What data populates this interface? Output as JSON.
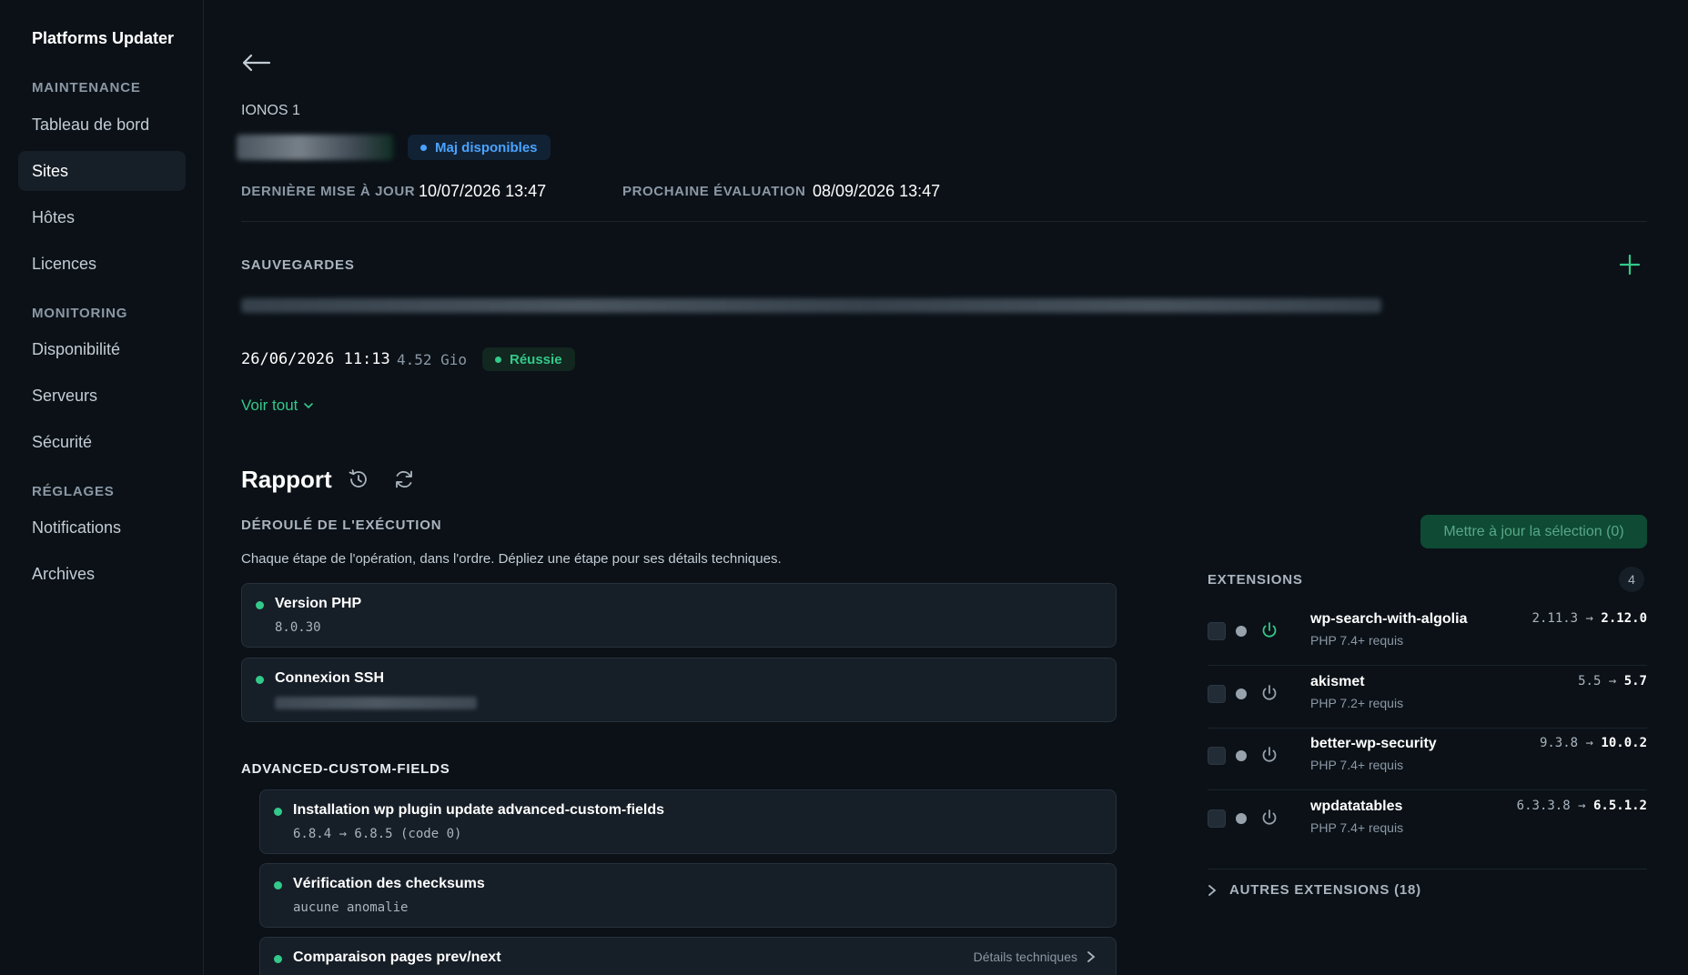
{
  "app": {
    "title": "Platforms Updater"
  },
  "sidebar": {
    "sections": [
      {
        "title": "MAINTENANCE",
        "items": [
          "Tableau de bord",
          "Sites",
          "Hôtes",
          "Licences"
        ]
      },
      {
        "title": "MONITORING",
        "items": [
          "Disponibilité",
          "Serveurs",
          "Sécurité"
        ]
      },
      {
        "title": "RÉGLAGES",
        "items": [
          "Notifications",
          "Archives"
        ]
      }
    ],
    "active": "Sites"
  },
  "site": {
    "host": "IONOS 1",
    "status_badge": "Maj disponibles",
    "last_update_label": "DERNIÈRE MISE À JOUR",
    "last_update_value": "10/07/2026 13:47",
    "next_eval_label": "PROCHAINE ÉVALUATION",
    "next_eval_value": "08/09/2026 13:47"
  },
  "backups": {
    "title": "SAUVEGARDES",
    "latest": {
      "date": "26/06/2026 11:13",
      "size": "4.52 Gio",
      "status": "Réussie"
    },
    "see_all": "Voir tout"
  },
  "report": {
    "title": "Rapport",
    "exec_title": "DÉROULÉ DE L'EXÉCUTION",
    "exec_desc": "Chaque étape de l'opération, dans l'ordre. Dépliez une étape pour ses détails techniques.",
    "steps": [
      {
        "title": "Version PHP",
        "sub": "8.0.30"
      },
      {
        "title": "Connexion SSH",
        "sub": ""
      }
    ],
    "group_title": "ADVANCED-CUSTOM-FIELDS",
    "group_steps": [
      {
        "title": "Installation wp plugin update advanced-custom-fields",
        "sub": "6.8.4 → 6.8.5 (code 0)"
      },
      {
        "title": "Vérification des checksums",
        "sub": "aucune anomalie"
      },
      {
        "title": "Comparaison pages prev/next",
        "details": "Détails techniques"
      }
    ]
  },
  "extensions": {
    "update_button": "Mettre à jour la sélection (0)",
    "title": "EXTENSIONS",
    "count": "4",
    "items": [
      {
        "name": "wp-search-with-algolia",
        "req": "PHP 7.4+ requis",
        "from": "2.11.3",
        "arrow": "→",
        "to": "2.12.0",
        "power_color": "#33c98a"
      },
      {
        "name": "akismet",
        "req": "PHP 7.2+ requis",
        "from": "5.5",
        "arrow": "→",
        "to": "5.7",
        "power_color": "#98a2ac"
      },
      {
        "name": "better-wp-security",
        "req": "PHP 7.4+ requis",
        "from": "9.3.8",
        "arrow": "→",
        "to": "10.0.2",
        "power_color": "#98a2ac"
      },
      {
        "name": "wpdatatables",
        "req": "PHP 7.4+ requis",
        "from": "6.3.3.8",
        "arrow": "→",
        "to": "6.5.1.2",
        "power_color": "#98a2ac"
      }
    ],
    "others": "AUTRES EXTENSIONS (18)"
  },
  "colors": {
    "accent": "#33c98a",
    "info": "#4aa3ff",
    "bg": "#0b1117",
    "card": "#161e27"
  }
}
